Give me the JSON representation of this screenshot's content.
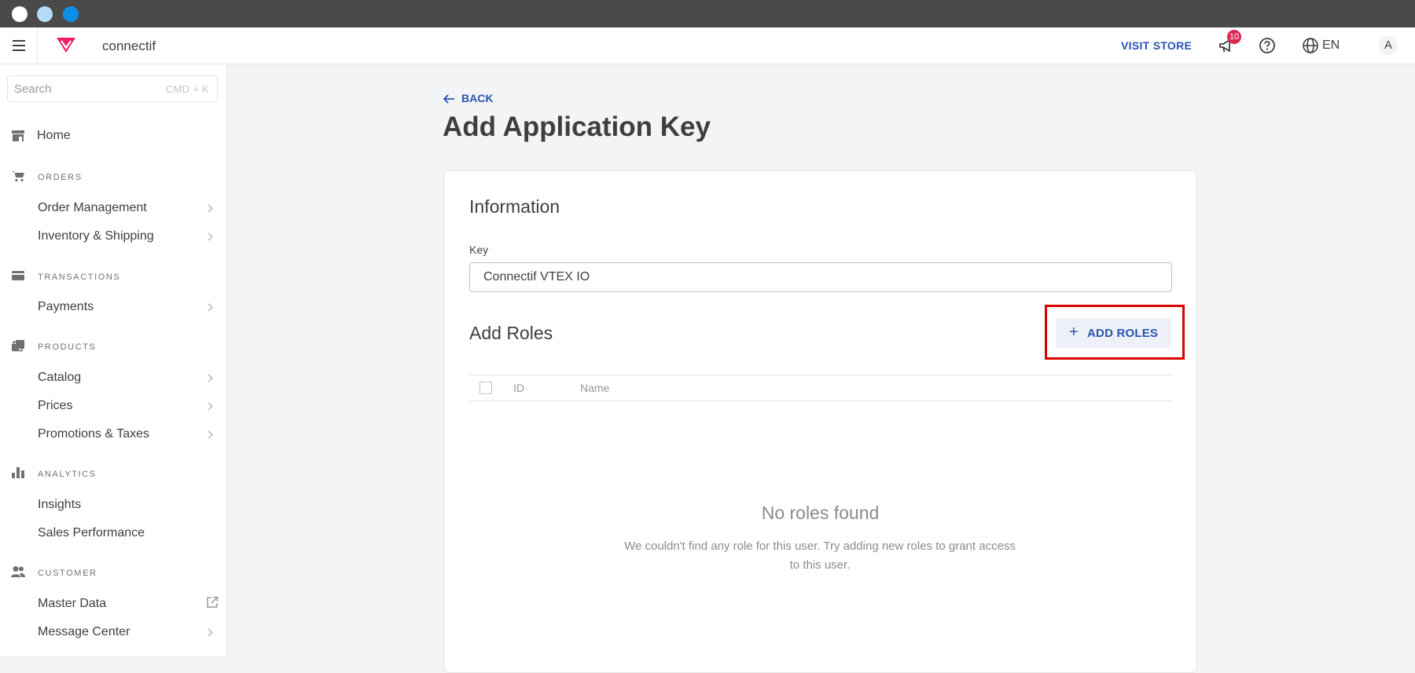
{
  "window": {
    "traffic_lights": [
      "#ffffff",
      "#b3dcf7",
      "#0f8ee8"
    ]
  },
  "header": {
    "app_name": "connectif",
    "visit_store": "VISIT STORE",
    "notifications_count": "10",
    "language": "EN",
    "avatar_initial": "A",
    "icons": [
      "menu-icon",
      "vtex-logo",
      "megaphone-icon",
      "help-icon",
      "globe-icon"
    ]
  },
  "sidebar": {
    "search_placeholder": "Search",
    "search_shortcut": "CMD + K",
    "home": "Home",
    "sections": [
      {
        "label": "ORDERS",
        "icon": "cart-icon",
        "items": [
          "Order Management",
          "Inventory & Shipping"
        ]
      },
      {
        "label": "TRANSACTIONS",
        "icon": "credit-card-icon",
        "items": [
          "Payments"
        ]
      },
      {
        "label": "PRODUCTS",
        "icon": "tags-icon",
        "items": [
          "Catalog",
          "Prices",
          "Promotions & Taxes"
        ]
      },
      {
        "label": "ANALYTICS",
        "icon": "bar-chart-icon",
        "items": [
          "Insights",
          "Sales Performance"
        ]
      },
      {
        "label": "CUSTOMER",
        "icon": "users-icon",
        "items": [
          "Master Data",
          "Message Center"
        ]
      }
    ]
  },
  "main": {
    "back": "BACK",
    "title": "Add Application Key",
    "information_title": "Information",
    "key_label": "Key",
    "key_value": "Connectif VTEX IO",
    "roles_title": "Add Roles",
    "add_roles_button": "ADD ROLES",
    "table_columns": [
      "ID",
      "Name"
    ],
    "empty_title": "No roles found",
    "empty_text": "We couldn't find any role for this user. Try adding new roles to grant access to this user."
  },
  "colors": {
    "accent": "#2953b2",
    "brand": "#f71963",
    "badge": "#dc2654",
    "highlight": "#d80000"
  }
}
